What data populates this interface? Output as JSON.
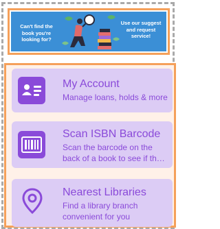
{
  "banner": {
    "left_text": "Can't find the\nbook you're\nlooking for?",
    "right_text": "Use our suggest\nand request\nservice!"
  },
  "cards": [
    {
      "title": "My Account",
      "subtitle": "Manage loans, holds & more",
      "icon": "id-card-icon"
    },
    {
      "title": "Scan ISBN Barcode",
      "subtitle_line1": "Scan the barcode on the",
      "subtitle_line2": "back of a book to see if th…",
      "icon": "barcode-icon"
    },
    {
      "title": "Nearest Libraries",
      "subtitle_line1": "Find a library branch",
      "subtitle_line2": "convenient for you",
      "icon": "location-pin-icon"
    }
  ],
  "colors": {
    "accent": "#8a4ad9",
    "card_bg": "#dcccf5",
    "banner_bg": "#3b8fd6",
    "border_orange": "#f5a05a"
  }
}
